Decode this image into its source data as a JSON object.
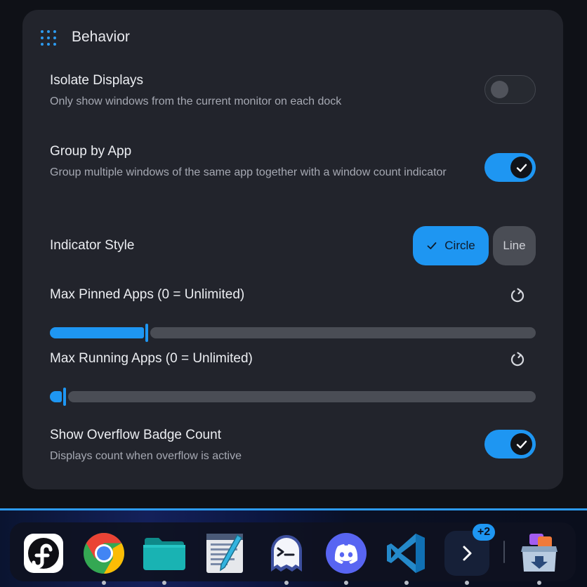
{
  "section": {
    "title": "Behavior",
    "icon": "grid-dots-icon"
  },
  "settings": {
    "isolate_displays": {
      "label": "Isolate Displays",
      "description": "Only show windows from the current monitor on each dock",
      "enabled": false
    },
    "group_by_app": {
      "label": "Group by App",
      "description": "Group multiple windows of the same app together with a window count indicator",
      "enabled": true
    },
    "indicator_style": {
      "label": "Indicator Style",
      "options": [
        "Circle",
        "Line"
      ],
      "selected": "Circle"
    },
    "max_pinned": {
      "label": "Max Pinned Apps (0 = Unlimited)",
      "fill_fraction": 0.2
    },
    "max_running": {
      "label": "Max Running Apps (0 = Unlimited)",
      "fill_fraction": 0.03
    },
    "overflow_badge": {
      "label": "Show Overflow Badge Count",
      "description": "Displays count when overflow is active",
      "enabled": true
    }
  },
  "dock": {
    "items": [
      {
        "name": "fedora-icon",
        "running": false
      },
      {
        "name": "chrome-icon",
        "running": true
      },
      {
        "name": "files-icon",
        "running": true
      },
      {
        "name": "text-editor-icon",
        "running": false
      },
      {
        "name": "ghost-terminal-icon",
        "running": true
      },
      {
        "name": "discord-icon",
        "running": true
      },
      {
        "name": "vscode-icon",
        "running": true
      },
      {
        "name": "overflow-button",
        "running": true
      },
      {
        "name": "software-store-icon",
        "running": true
      }
    ],
    "overflow_count": "+2"
  },
  "colors": {
    "accent": "#1e96f2",
    "card": "#22242c",
    "background": "#0f1117"
  }
}
